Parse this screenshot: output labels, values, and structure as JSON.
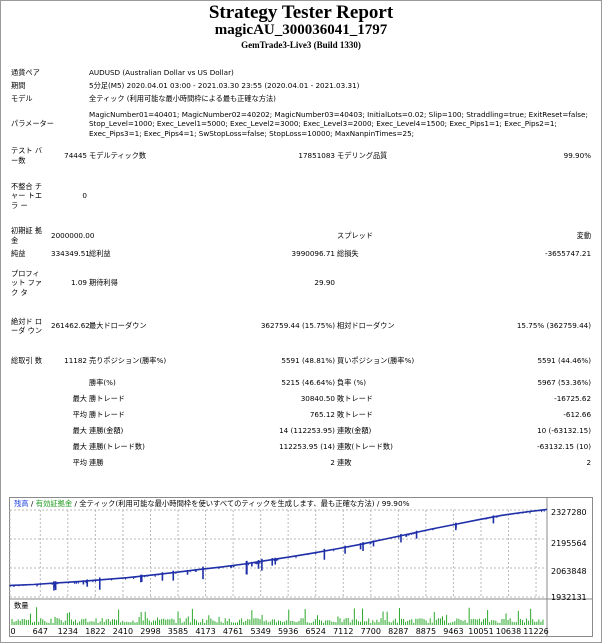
{
  "header": {
    "title": "Strategy Tester Report",
    "subtitle": "magicAU_300036041_1797",
    "server": "GemTrade3-Live3 (Build 1330)"
  },
  "info": [
    {
      "label": "通貨ペア",
      "value": "AUDUSD (Australian Dollar vs US Dollar)"
    },
    {
      "label": "期間",
      "value": "5分足(M5) 2020.04.01 03:00 - 2021.03.30 23:55 (2020.04.01 - 2021.03.31)"
    },
    {
      "label": "モデル",
      "value": "全ティック (利用可能な最小時間枠による最も正確な方法)"
    },
    {
      "label": "パラメーター",
      "value": "MagicNumber01=40401; MagicNumber02=40202; MagicNumber03=40403; InitialLots=0.02; Slip=100; Straddling=true; ExitReset=false; Stop_Level=1000; Exec_Level1=5000; Exec_Level2=3000; Exec_Level3=2000; Exec_Level4=1500; Exec_Pips1=1; Exec_Pips2=1; Exec_Pips3=1; Exec_Pips4=1; SwStopLoss=false; StopLoss=10000; MaxNanpinTimes=25;"
    }
  ],
  "rows": {
    "bars_label": "テスト バー数",
    "bars": "74445",
    "ticks_label": "モデルティック数",
    "ticks": "17851083",
    "quality_label": "モデリング品質",
    "quality": "99.90%",
    "mismatch_label": "不整合 チャー トエラ ー",
    "mismatch": "0",
    "deposit_label": "初期証 拠金",
    "deposit": "2000000.00",
    "spread_label": "スプレッド",
    "spread": "変動",
    "net_label": "純益",
    "net": "334349.51",
    "gross_profit_label": "総利益",
    "gross_profit": "3990096.71",
    "gross_loss_label": "総損失",
    "gross_loss": "-3655747.21",
    "pf_label": "プロフィ ット ファク タ",
    "pf": "1.09",
    "payoff_label": "期待利得",
    "payoff": "29.90",
    "abs_dd_label": "絶対ド ローダ ウン",
    "abs_dd": "261462.62",
    "max_dd_label": "最大ドローダウン",
    "max_dd": "362759.44 (15.75%)",
    "rel_dd_label": "相対ドローダウン",
    "rel_dd": "15.75% (362759.44)",
    "total_label": "総取引 数",
    "total": "11182",
    "short_label": "売りポジション(勝率%)",
    "short": "5591 (48.81%)",
    "long_label": "買いポジション(勝率%)",
    "long": "5591 (44.46%)",
    "win_label": "勝率(%)",
    "win": "5215 (46.64%)",
    "loss_label": "負率 (%)",
    "loss": "5967 (53.36%)",
    "max_word": "最大",
    "avg_word": "平均",
    "largest_win_label": "勝トレード",
    "largest_win": "30840.50",
    "largest_loss_label": "敗トレード",
    "largest_loss": "-16725.62",
    "avg_win_label": "勝トレード",
    "avg_win": "765.12",
    "avg_loss_label": "敗トレード",
    "avg_loss": "-612.66",
    "cons_wins_label": "連勝(金額)",
    "cons_wins": "14 (112253.95)",
    "cons_losses_label": "連敗(金額)",
    "cons_losses": "10 (-63132.15)",
    "cons_profit_label": "連勝(トレード数)",
    "cons_profit": "112253.95 (14)",
    "cons_loss_label": "連敗(トレード数)",
    "cons_loss": "-63132.15 (10)",
    "avg_cons_wins_label": "連勝",
    "avg_cons_wins": "2",
    "avg_cons_losses_label": "連敗",
    "avg_cons_losses": "2"
  },
  "chart_data": {
    "type": "line",
    "legend": {
      "balance": "残高",
      "sep1": " / ",
      "equity": "有効証拠金",
      "sep2": " / ",
      "model": "全ティック(利用可能な最小時間枠を使いすべてのティックを生成します、最も正確な方法) / 99.90%"
    },
    "y_ticks": [
      "2327280",
      "2195564",
      "2063848",
      "1932131"
    ],
    "y_range": [
      1932131,
      2327280
    ],
    "x_ticks": [
      "0",
      "647",
      "1234",
      "1822",
      "2410",
      "2998",
      "3585",
      "4173",
      "4761",
      "5349",
      "5936",
      "6524",
      "7112",
      "7700",
      "8287",
      "8875",
      "9463",
      "10051",
      "10638",
      "11226"
    ],
    "x_range": [
      0,
      11460
    ],
    "volume_label": "数量",
    "balance": [
      [
        0,
        1985000
      ],
      [
        500,
        1989000
      ],
      [
        1000,
        1996000
      ],
      [
        1500,
        2003000
      ],
      [
        2000,
        2011000
      ],
      [
        2500,
        2020000
      ],
      [
        3000,
        2031000
      ],
      [
        3500,
        2043000
      ],
      [
        4000,
        2056000
      ],
      [
        4500,
        2068000
      ],
      [
        5000,
        2082000
      ],
      [
        5500,
        2099000
      ],
      [
        6000,
        2115000
      ],
      [
        6500,
        2133000
      ],
      [
        7000,
        2152000
      ],
      [
        7500,
        2172000
      ],
      [
        8000,
        2195000
      ],
      [
        8500,
        2218000
      ],
      [
        9000,
        2241000
      ],
      [
        9500,
        2262000
      ],
      [
        10000,
        2283000
      ],
      [
        10500,
        2303000
      ],
      [
        11000,
        2318000
      ],
      [
        11460,
        2330000
      ]
    ],
    "colors": {
      "balance": "#1f2fa8",
      "equity": "#1d9a1d",
      "grid": "#b9b9b9",
      "bars": "#2aa82a"
    }
  }
}
